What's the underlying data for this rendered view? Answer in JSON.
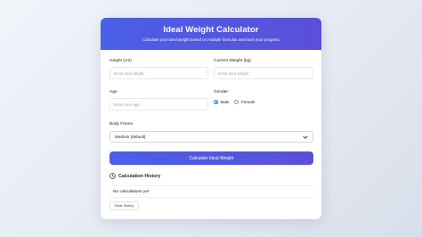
{
  "header": {
    "title": "Ideal Weight Calculator",
    "subtitle": "Calculate your ideal weight based on multiple formulas and track your progress"
  },
  "form": {
    "height_label": "Height (cm)",
    "height_placeholder": "Enter your height",
    "weight_label": "Current Weight (kg)",
    "weight_placeholder": "Enter your weight",
    "age_label": "Age",
    "age_placeholder": "Enter your age",
    "gender_label": "Gender",
    "gender_options": [
      "Male",
      "Female"
    ],
    "gender_selected": "Male",
    "frame_label": "Body Frame",
    "frame_value": "Medium (default)",
    "calculate_label": "Calculate Ideal Weight"
  },
  "history": {
    "title": "Calculation History",
    "empty_text": "No calculations yet",
    "clear_label": "Clear History"
  },
  "colors": {
    "accent": "#4a60e8",
    "accent_end": "#5a4fd9",
    "radio": "#2f6ff0"
  }
}
